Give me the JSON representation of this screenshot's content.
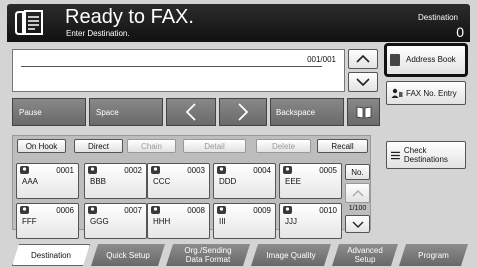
{
  "header": {
    "title": "Ready to FAX.",
    "subtitle": "Enter Destination.",
    "right_label": "Destination",
    "right_badge": "0"
  },
  "destination_area": {
    "counter": "001/001"
  },
  "input_bar": {
    "pause": "Pause",
    "space": "Space",
    "backspace": "Backspace"
  },
  "side": {
    "address_book": "Address Book",
    "fax_no_entry": "FAX No. Entry",
    "check_destinations": "Check Destinations"
  },
  "toolbar": {
    "on_hook": "On Hook",
    "direct": "Direct",
    "chain": "Chain",
    "detail": "Detail",
    "delete": "Delete",
    "recall": "Recall"
  },
  "one_touch": [
    {
      "number": "0001",
      "name": "AAA"
    },
    {
      "number": "0002",
      "name": "BBB"
    },
    {
      "number": "0003",
      "name": "CCC"
    },
    {
      "number": "0004",
      "name": "DDD"
    },
    {
      "number": "0005",
      "name": "EEE"
    },
    {
      "number": "0006",
      "name": "FFF"
    },
    {
      "number": "0007",
      "name": "GGG"
    },
    {
      "number": "0008",
      "name": "HHH"
    },
    {
      "number": "0009",
      "name": "III"
    },
    {
      "number": "0010",
      "name": "JJJ"
    }
  ],
  "pager": {
    "no_label": "No.",
    "page": "1/100"
  },
  "tabs": [
    "Destination",
    "Quick Setup",
    "Org./Sending Data Format",
    "Image Quality",
    "Advanced Setup",
    "Program"
  ]
}
